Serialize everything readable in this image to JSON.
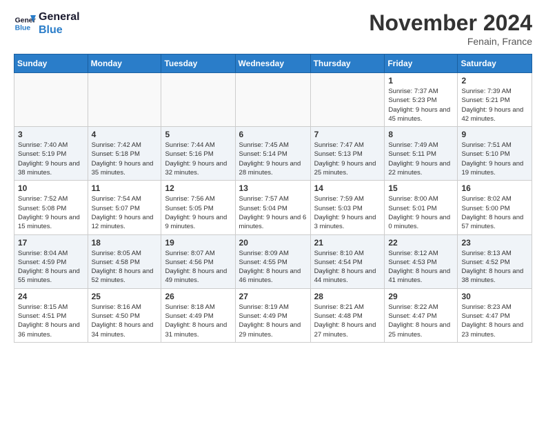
{
  "header": {
    "logo_line1": "General",
    "logo_line2": "Blue",
    "month": "November 2024",
    "location": "Fenain, France"
  },
  "days_of_week": [
    "Sunday",
    "Monday",
    "Tuesday",
    "Wednesday",
    "Thursday",
    "Friday",
    "Saturday"
  ],
  "weeks": [
    [
      {
        "day": "",
        "info": ""
      },
      {
        "day": "",
        "info": ""
      },
      {
        "day": "",
        "info": ""
      },
      {
        "day": "",
        "info": ""
      },
      {
        "day": "",
        "info": ""
      },
      {
        "day": "1",
        "info": "Sunrise: 7:37 AM\nSunset: 5:23 PM\nDaylight: 9 hours and 45 minutes."
      },
      {
        "day": "2",
        "info": "Sunrise: 7:39 AM\nSunset: 5:21 PM\nDaylight: 9 hours and 42 minutes."
      }
    ],
    [
      {
        "day": "3",
        "info": "Sunrise: 7:40 AM\nSunset: 5:19 PM\nDaylight: 9 hours and 38 minutes."
      },
      {
        "day": "4",
        "info": "Sunrise: 7:42 AM\nSunset: 5:18 PM\nDaylight: 9 hours and 35 minutes."
      },
      {
        "day": "5",
        "info": "Sunrise: 7:44 AM\nSunset: 5:16 PM\nDaylight: 9 hours and 32 minutes."
      },
      {
        "day": "6",
        "info": "Sunrise: 7:45 AM\nSunset: 5:14 PM\nDaylight: 9 hours and 28 minutes."
      },
      {
        "day": "7",
        "info": "Sunrise: 7:47 AM\nSunset: 5:13 PM\nDaylight: 9 hours and 25 minutes."
      },
      {
        "day": "8",
        "info": "Sunrise: 7:49 AM\nSunset: 5:11 PM\nDaylight: 9 hours and 22 minutes."
      },
      {
        "day": "9",
        "info": "Sunrise: 7:51 AM\nSunset: 5:10 PM\nDaylight: 9 hours and 19 minutes."
      }
    ],
    [
      {
        "day": "10",
        "info": "Sunrise: 7:52 AM\nSunset: 5:08 PM\nDaylight: 9 hours and 15 minutes."
      },
      {
        "day": "11",
        "info": "Sunrise: 7:54 AM\nSunset: 5:07 PM\nDaylight: 9 hours and 12 minutes."
      },
      {
        "day": "12",
        "info": "Sunrise: 7:56 AM\nSunset: 5:05 PM\nDaylight: 9 hours and 9 minutes."
      },
      {
        "day": "13",
        "info": "Sunrise: 7:57 AM\nSunset: 5:04 PM\nDaylight: 9 hours and 6 minutes."
      },
      {
        "day": "14",
        "info": "Sunrise: 7:59 AM\nSunset: 5:03 PM\nDaylight: 9 hours and 3 minutes."
      },
      {
        "day": "15",
        "info": "Sunrise: 8:00 AM\nSunset: 5:01 PM\nDaylight: 9 hours and 0 minutes."
      },
      {
        "day": "16",
        "info": "Sunrise: 8:02 AM\nSunset: 5:00 PM\nDaylight: 8 hours and 57 minutes."
      }
    ],
    [
      {
        "day": "17",
        "info": "Sunrise: 8:04 AM\nSunset: 4:59 PM\nDaylight: 8 hours and 55 minutes."
      },
      {
        "day": "18",
        "info": "Sunrise: 8:05 AM\nSunset: 4:58 PM\nDaylight: 8 hours and 52 minutes."
      },
      {
        "day": "19",
        "info": "Sunrise: 8:07 AM\nSunset: 4:56 PM\nDaylight: 8 hours and 49 minutes."
      },
      {
        "day": "20",
        "info": "Sunrise: 8:09 AM\nSunset: 4:55 PM\nDaylight: 8 hours and 46 minutes."
      },
      {
        "day": "21",
        "info": "Sunrise: 8:10 AM\nSunset: 4:54 PM\nDaylight: 8 hours and 44 minutes."
      },
      {
        "day": "22",
        "info": "Sunrise: 8:12 AM\nSunset: 4:53 PM\nDaylight: 8 hours and 41 minutes."
      },
      {
        "day": "23",
        "info": "Sunrise: 8:13 AM\nSunset: 4:52 PM\nDaylight: 8 hours and 38 minutes."
      }
    ],
    [
      {
        "day": "24",
        "info": "Sunrise: 8:15 AM\nSunset: 4:51 PM\nDaylight: 8 hours and 36 minutes."
      },
      {
        "day": "25",
        "info": "Sunrise: 8:16 AM\nSunset: 4:50 PM\nDaylight: 8 hours and 34 minutes."
      },
      {
        "day": "26",
        "info": "Sunrise: 8:18 AM\nSunset: 4:49 PM\nDaylight: 8 hours and 31 minutes."
      },
      {
        "day": "27",
        "info": "Sunrise: 8:19 AM\nSunset: 4:49 PM\nDaylight: 8 hours and 29 minutes."
      },
      {
        "day": "28",
        "info": "Sunrise: 8:21 AM\nSunset: 4:48 PM\nDaylight: 8 hours and 27 minutes."
      },
      {
        "day": "29",
        "info": "Sunrise: 8:22 AM\nSunset: 4:47 PM\nDaylight: 8 hours and 25 minutes."
      },
      {
        "day": "30",
        "info": "Sunrise: 8:23 AM\nSunset: 4:47 PM\nDaylight: 8 hours and 23 minutes."
      }
    ]
  ]
}
